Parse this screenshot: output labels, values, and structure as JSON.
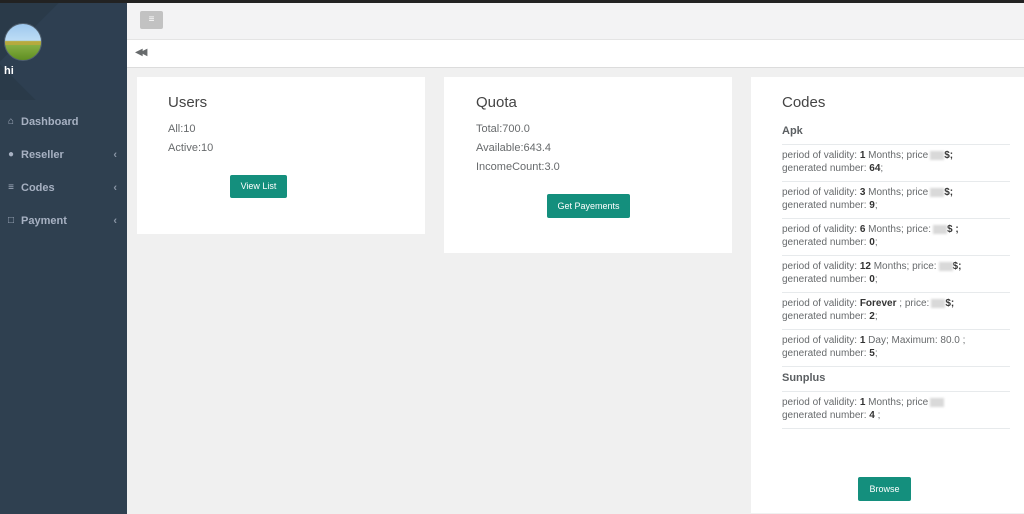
{
  "profile": {
    "username": "hi"
  },
  "nav": [
    {
      "icon": "home-icon",
      "label": "Dashboard",
      "chevron": ""
    },
    {
      "icon": "user-icon",
      "label": "Reseller",
      "chevron": "‹"
    },
    {
      "icon": "list-icon",
      "label": "Codes",
      "chevron": "‹"
    },
    {
      "icon": "edit-icon",
      "label": "Payment",
      "chevron": "‹"
    }
  ],
  "topbar": {
    "menu_icon": "≡",
    "back_icon": "◀◀"
  },
  "users": {
    "title": "Users",
    "all": "All:10",
    "active": "Active:10",
    "button": "View List"
  },
  "quota": {
    "title": "Quota",
    "total": "Total:700.0",
    "available": "Available:643.4",
    "income": "IncomeCount:3.0",
    "button": "Get Payements"
  },
  "codes": {
    "title": "Codes",
    "apk_title": "Apk",
    "apk": [
      {
        "prefix": "period of validity: ",
        "bold": "1",
        "mid": " Months; price",
        "suffix": "$;",
        "line2": "generated number: ",
        "count": "64",
        "tail": ";"
      },
      {
        "prefix": "period of validity: ",
        "bold": "3",
        "mid": " Months; price",
        "suffix": "$;",
        "line2": "generated number: ",
        "count": "9",
        "tail": ";"
      },
      {
        "prefix": "period of validity: ",
        "bold": "6",
        "mid": " Months; price:",
        "suffix": "$ ;",
        "line2": "generated number: ",
        "count": "0",
        "tail": ";"
      },
      {
        "prefix": "period of validity: ",
        "bold": "12",
        "mid": " Months; price:",
        "suffix": "$;",
        "line2": "generated number: ",
        "count": "0",
        "tail": ";"
      },
      {
        "prefix": "period of validity: ",
        "bold": "Forever",
        "mid": " ; price:",
        "suffix": "$;",
        "line2": "generated number: ",
        "count": "2",
        "tail": ";"
      },
      {
        "prefix": "period of validity: ",
        "bold": "1",
        "mid": " Day; Maximum: 80.0 ;",
        "suffix": "",
        "line2": "generated number: ",
        "count": "5",
        "tail": ";"
      }
    ],
    "sunplus_title": "Sunplus",
    "sunplus": [
      {
        "prefix": "period of validity: ",
        "bold": "1",
        "mid": " Months; price",
        "suffix": "",
        "line2": "generated number: ",
        "count": "4",
        "tail": " ;"
      }
    ],
    "button": "Browse"
  },
  "colors": {
    "sidebar": "#2f4050",
    "accent": "#148f7d",
    "background": "#f0f0f0"
  }
}
